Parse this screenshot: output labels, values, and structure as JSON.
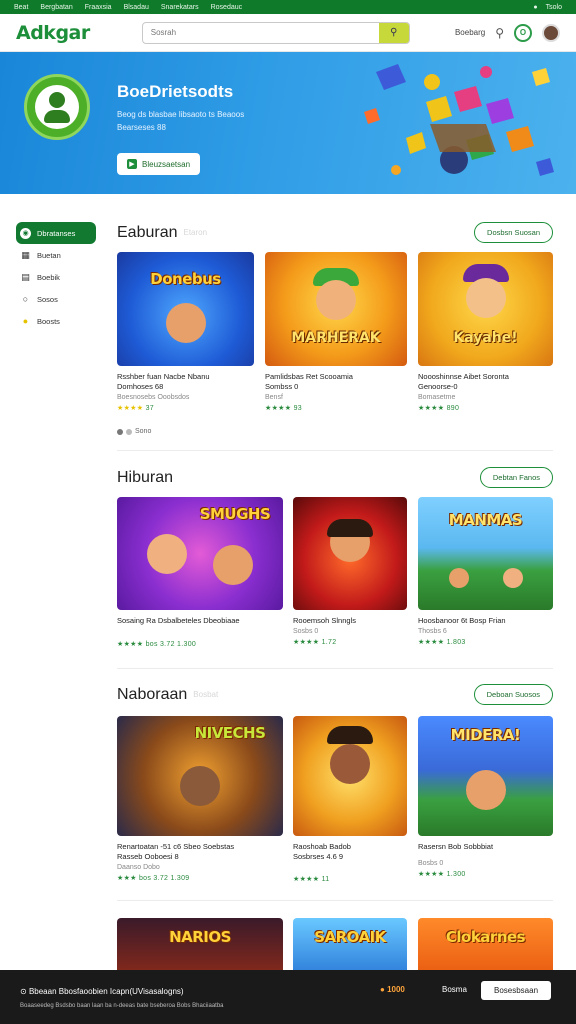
{
  "topbar": {
    "links": [
      "Beat",
      "Bergbatan",
      "Fraaxsia",
      "Blsadau",
      "Snarekatars",
      "Rosedauc"
    ],
    "right": "Tsolo"
  },
  "header": {
    "logo": "Adkgar",
    "search_placeholder": "Sosrah",
    "account_label": "Boebarg"
  },
  "hero": {
    "title": "BoeDrietsodts",
    "subtitle_line1": "Beog ds blasbae libsaoto ts Beaoos",
    "subtitle_line2": "Bearseses 88",
    "cta_label": "Bleuzsaetsan"
  },
  "sidebar": {
    "items": [
      {
        "label": "Dbratanses",
        "icon": "gamepad-icon"
      },
      {
        "label": "Buetan",
        "icon": "grid-icon"
      },
      {
        "label": "Boebik",
        "icon": "calendar-icon"
      },
      {
        "label": "Sosos",
        "icon": "circle-icon"
      },
      {
        "label": "Boosts",
        "icon": "coin-icon"
      }
    ]
  },
  "sections": [
    {
      "title": "Eaburan",
      "ghost": "Etaron",
      "see_all": "Dosbsn Suosan",
      "pager": "Sono",
      "cards": [
        {
          "thumb_title": "Donebus",
          "title_line1": "Rsshber fuan Nacbe Nbanu",
          "title_line2": "Domhoses 68",
          "meta": "Boesnosebs Ooobsdos",
          "stars": "★★★★",
          "rating": "37"
        },
        {
          "thumb_title": "MARHERAK",
          "title_line1": "Pamlidsbas  Ret  Scooamia",
          "title_line2": "Sombss  0",
          "meta": "Bensf",
          "stars": "★★★★",
          "rating": "93"
        },
        {
          "thumb_title": "Kayahe!",
          "title_line1": "Noooshinnse Aibet Soronta",
          "title_line2": "Genoorse-0",
          "meta": "Bomasetme",
          "stars": "★★★★",
          "rating": "890"
        }
      ]
    },
    {
      "title": "Hiburan",
      "ghost": "",
      "see_all": "Debtan Fanos",
      "pager": "",
      "cards": [
        {
          "thumb_title": "SMUGHS",
          "title_line1": "Sosaing  Ra  Dsbalbeteles  Dbeobiaae",
          "title_line2": "",
          "meta": "",
          "stars": "★★★★",
          "rating": "bos   3.72  1.300"
        },
        {
          "thumb_title": "",
          "title_line1": "Rooemsoh  Slnngls",
          "title_line2": "",
          "meta": "Sosbs 0",
          "stars": "★★★★",
          "rating": "1.72"
        },
        {
          "thumb_title": "MANMAS",
          "title_line1": "Hoosbanoor  6t  Bosp  Frian",
          "title_line2": "",
          "meta": "Thosbs 6",
          "stars": "★★★★",
          "rating": "1.803"
        }
      ]
    },
    {
      "title": "Naboraan",
      "ghost": "Bosbat",
      "see_all": "Deboan Suosos",
      "pager": "",
      "cards": [
        {
          "thumb_title": "NIVECHS",
          "title_line1": "Renartoatan -51  c6 Sbeo  Soebstas",
          "title_line2": "Rasseb Ooboesi 8",
          "meta": "Daanso Dobo",
          "stars": "★★★",
          "rating": "bos   3.72  1.309"
        },
        {
          "thumb_title": "",
          "title_line1": "Raoshoab  Badob",
          "title_line2": "Sosbrses  4.6  9",
          "meta": "",
          "stars": "★★★★",
          "rating": "11"
        },
        {
          "thumb_title": "MIDERA!",
          "title_line1": "Rasersn  Bob  Sobbbiat",
          "title_line2": "",
          "meta": "Bosbs   0",
          "stars": "★★★★",
          "rating": "1.300"
        }
      ]
    },
    {
      "title": "",
      "ghost": "",
      "see_all": "",
      "pager": "",
      "cards": [
        {
          "thumb_title": "NARIOS",
          "title_line1": "",
          "title_line2": "",
          "meta": "",
          "stars": "",
          "rating": ""
        },
        {
          "thumb_title": "SAROAIK",
          "title_line1": "",
          "title_line2": "",
          "meta": "",
          "stars": "",
          "rating": ""
        },
        {
          "thumb_title": "Clokarnes",
          "title_line1": "",
          "title_line2": "",
          "meta": "",
          "stars": "",
          "rating": ""
        }
      ]
    }
  ],
  "cookie": {
    "message": "Bbeaan Bbosfaoobien Icapn(UVisasalogns)",
    "detail": "Boaaseedeg Bsdsbo baan laan ba n-deeas bate bseberoa  Bobs Bhaciiaatba",
    "coins": "1000",
    "games_label": "Bosma",
    "accept_label": "Bosesbsaan"
  }
}
